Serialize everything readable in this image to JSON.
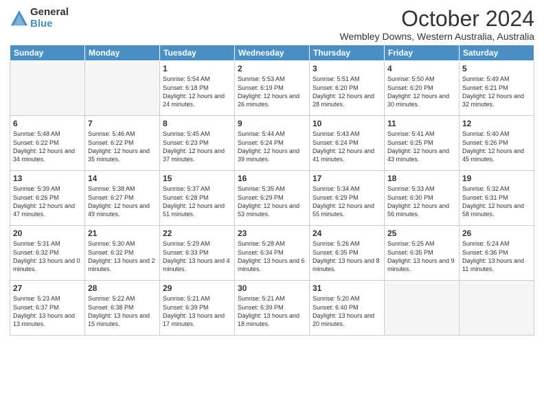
{
  "logo": {
    "general": "General",
    "blue": "Blue"
  },
  "title": "October 2024",
  "subtitle": "Wembley Downs, Western Australia, Australia",
  "weekdays": [
    "Sunday",
    "Monday",
    "Tuesday",
    "Wednesday",
    "Thursday",
    "Friday",
    "Saturday"
  ],
  "weeks": [
    [
      {
        "day": "",
        "info": ""
      },
      {
        "day": "",
        "info": ""
      },
      {
        "day": "1",
        "info": "Sunrise: 5:54 AM\nSunset: 6:18 PM\nDaylight: 12 hours and 24 minutes."
      },
      {
        "day": "2",
        "info": "Sunrise: 5:53 AM\nSunset: 6:19 PM\nDaylight: 12 hours and 26 minutes."
      },
      {
        "day": "3",
        "info": "Sunrise: 5:51 AM\nSunset: 6:20 PM\nDaylight: 12 hours and 28 minutes."
      },
      {
        "day": "4",
        "info": "Sunrise: 5:50 AM\nSunset: 6:20 PM\nDaylight: 12 hours and 30 minutes."
      },
      {
        "day": "5",
        "info": "Sunrise: 5:49 AM\nSunset: 6:21 PM\nDaylight: 12 hours and 32 minutes."
      }
    ],
    [
      {
        "day": "6",
        "info": "Sunrise: 5:48 AM\nSunset: 6:22 PM\nDaylight: 12 hours and 34 minutes."
      },
      {
        "day": "7",
        "info": "Sunrise: 5:46 AM\nSunset: 6:22 PM\nDaylight: 12 hours and 35 minutes."
      },
      {
        "day": "8",
        "info": "Sunrise: 5:45 AM\nSunset: 6:23 PM\nDaylight: 12 hours and 37 minutes."
      },
      {
        "day": "9",
        "info": "Sunrise: 5:44 AM\nSunset: 6:24 PM\nDaylight: 12 hours and 39 minutes."
      },
      {
        "day": "10",
        "info": "Sunrise: 5:43 AM\nSunset: 6:24 PM\nDaylight: 12 hours and 41 minutes."
      },
      {
        "day": "11",
        "info": "Sunrise: 5:41 AM\nSunset: 6:25 PM\nDaylight: 12 hours and 43 minutes."
      },
      {
        "day": "12",
        "info": "Sunrise: 5:40 AM\nSunset: 6:26 PM\nDaylight: 12 hours and 45 minutes."
      }
    ],
    [
      {
        "day": "13",
        "info": "Sunrise: 5:39 AM\nSunset: 6:26 PM\nDaylight: 12 hours and 47 minutes."
      },
      {
        "day": "14",
        "info": "Sunrise: 5:38 AM\nSunset: 6:27 PM\nDaylight: 12 hours and 49 minutes."
      },
      {
        "day": "15",
        "info": "Sunrise: 5:37 AM\nSunset: 6:28 PM\nDaylight: 12 hours and 51 minutes."
      },
      {
        "day": "16",
        "info": "Sunrise: 5:35 AM\nSunset: 6:29 PM\nDaylight: 12 hours and 53 minutes."
      },
      {
        "day": "17",
        "info": "Sunrise: 5:34 AM\nSunset: 6:29 PM\nDaylight: 12 hours and 55 minutes."
      },
      {
        "day": "18",
        "info": "Sunrise: 5:33 AM\nSunset: 6:30 PM\nDaylight: 12 hours and 56 minutes."
      },
      {
        "day": "19",
        "info": "Sunrise: 5:32 AM\nSunset: 6:31 PM\nDaylight: 12 hours and 58 minutes."
      }
    ],
    [
      {
        "day": "20",
        "info": "Sunrise: 5:31 AM\nSunset: 6:32 PM\nDaylight: 13 hours and 0 minutes."
      },
      {
        "day": "21",
        "info": "Sunrise: 5:30 AM\nSunset: 6:32 PM\nDaylight: 13 hours and 2 minutes."
      },
      {
        "day": "22",
        "info": "Sunrise: 5:29 AM\nSunset: 6:33 PM\nDaylight: 13 hours and 4 minutes."
      },
      {
        "day": "23",
        "info": "Sunrise: 5:28 AM\nSunset: 6:34 PM\nDaylight: 13 hours and 6 minutes."
      },
      {
        "day": "24",
        "info": "Sunrise: 5:26 AM\nSunset: 6:35 PM\nDaylight: 13 hours and 8 minutes."
      },
      {
        "day": "25",
        "info": "Sunrise: 5:25 AM\nSunset: 6:35 PM\nDaylight: 13 hours and 9 minutes."
      },
      {
        "day": "26",
        "info": "Sunrise: 5:24 AM\nSunset: 6:36 PM\nDaylight: 13 hours and 11 minutes."
      }
    ],
    [
      {
        "day": "27",
        "info": "Sunrise: 5:23 AM\nSunset: 6:37 PM\nDaylight: 13 hours and 13 minutes."
      },
      {
        "day": "28",
        "info": "Sunrise: 5:22 AM\nSunset: 6:38 PM\nDaylight: 13 hours and 15 minutes."
      },
      {
        "day": "29",
        "info": "Sunrise: 5:21 AM\nSunset: 6:39 PM\nDaylight: 13 hours and 17 minutes."
      },
      {
        "day": "30",
        "info": "Sunrise: 5:21 AM\nSunset: 6:39 PM\nDaylight: 13 hours and 18 minutes."
      },
      {
        "day": "31",
        "info": "Sunrise: 5:20 AM\nSunset: 6:40 PM\nDaylight: 13 hours and 20 minutes."
      },
      {
        "day": "",
        "info": ""
      },
      {
        "day": "",
        "info": ""
      }
    ]
  ]
}
